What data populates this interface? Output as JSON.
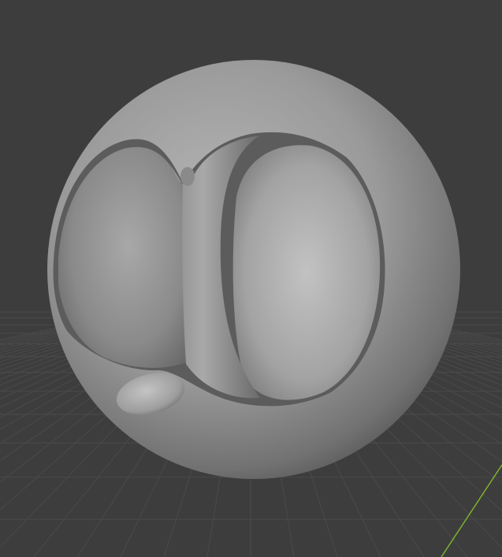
{
  "viewport": {
    "background_color": "#3d3d3d",
    "grid_line_color": "#4a4a4a",
    "x_axis_color": "#7fb12f",
    "object": {
      "shading": "solid-gray",
      "base_color": "#8a8a8a"
    }
  }
}
